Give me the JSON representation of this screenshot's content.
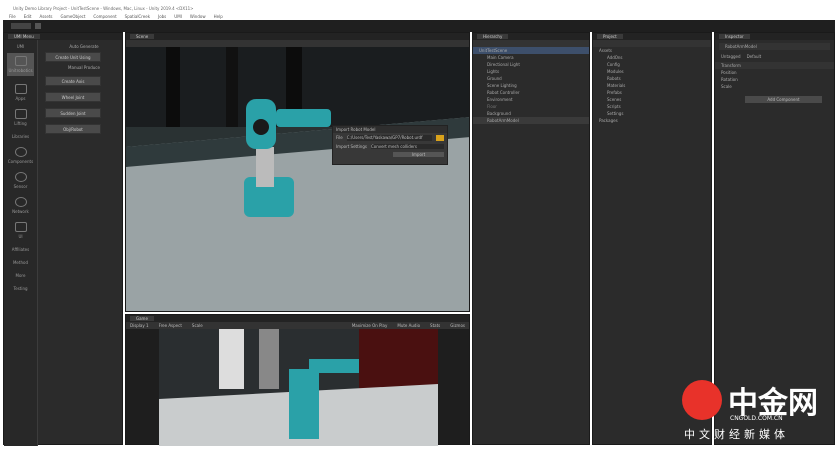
{
  "window": {
    "title": "Unity Demo Library Project - UnitTestScene - Windows, Mac, Linux - Unity 2019.4 <DX11>"
  },
  "menu": [
    "File",
    "Edit",
    "Assets",
    "GameObject",
    "Component",
    "SpatialCreek",
    "Jobs",
    "UMI",
    "Window",
    "Help"
  ],
  "left_panel": {
    "tab": "UMI Menu",
    "sections": [
      "UMI",
      "Libraries",
      "Affiliates"
    ],
    "sidebar": [
      "Unitrobotics",
      "Apps",
      "Lifting",
      "Components",
      "Sensor",
      "Network",
      "UI",
      "Method",
      "More",
      "Testing"
    ],
    "header": "Auto Generate",
    "subheader": "Manual Produce",
    "buttons": [
      "Create Unit Using",
      "Create Axis",
      "Wheel Joint",
      "Sudden Joint",
      "Obj/Robot"
    ]
  },
  "scene": {
    "tab": "Scene",
    "dialog": {
      "title": "Import Robot Model",
      "field1_label": "File",
      "field1_value": "C:/Users/Test/Yaskawa/GP7/Robot.urdf",
      "field2_label": "Import Settings",
      "field2_value": "Convert mesh colliders",
      "button": "Import"
    }
  },
  "game": {
    "tab": "Game",
    "display": "Display 1",
    "aspect": "Free Aspect",
    "scale": "Scale",
    "toolbar_right": [
      "Maximize On Play",
      "Mute Audio",
      "Stats",
      "Gizmos"
    ]
  },
  "hierarchy": {
    "tab": "Hierarchy",
    "items": [
      "UnitTestScene",
      "Main Camera",
      "Directional Light",
      "Lights",
      "Ground",
      "Scene Lighting",
      "Robot Controller",
      "Environment",
      "Floor",
      "Background",
      "RobotArmModel"
    ]
  },
  "project": {
    "tab": "Project",
    "items": [
      "Assets",
      "AddOns",
      "Config",
      "Modules",
      "Robots",
      "Materials",
      "Prefabs",
      "Scenes",
      "Scripts",
      "Settings",
      "Packages"
    ]
  },
  "inspector": {
    "tab": "Inspector",
    "object": "RobotArmModel",
    "tag": "Untagged",
    "layer": "Default",
    "component": "Transform",
    "props": [
      "Position",
      "Rotation",
      "Scale"
    ],
    "add_button": "Add Component"
  },
  "watermark": {
    "brand": "中金网",
    "site": "CNGOLD.COM.CN",
    "tagline": "中文财经新媒体",
    "color": "#e8322a"
  }
}
